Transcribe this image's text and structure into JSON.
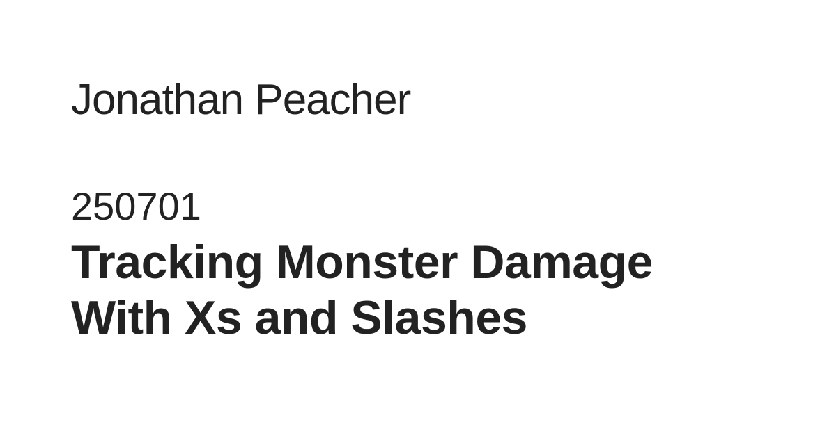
{
  "author": "Jonathan Peacher",
  "post_id": "250701",
  "title_lines": [
    "Tracking Monster Damage",
    "With Xs and Slashes"
  ],
  "colors": {
    "background": "#ffffff",
    "text": "#222222"
  }
}
